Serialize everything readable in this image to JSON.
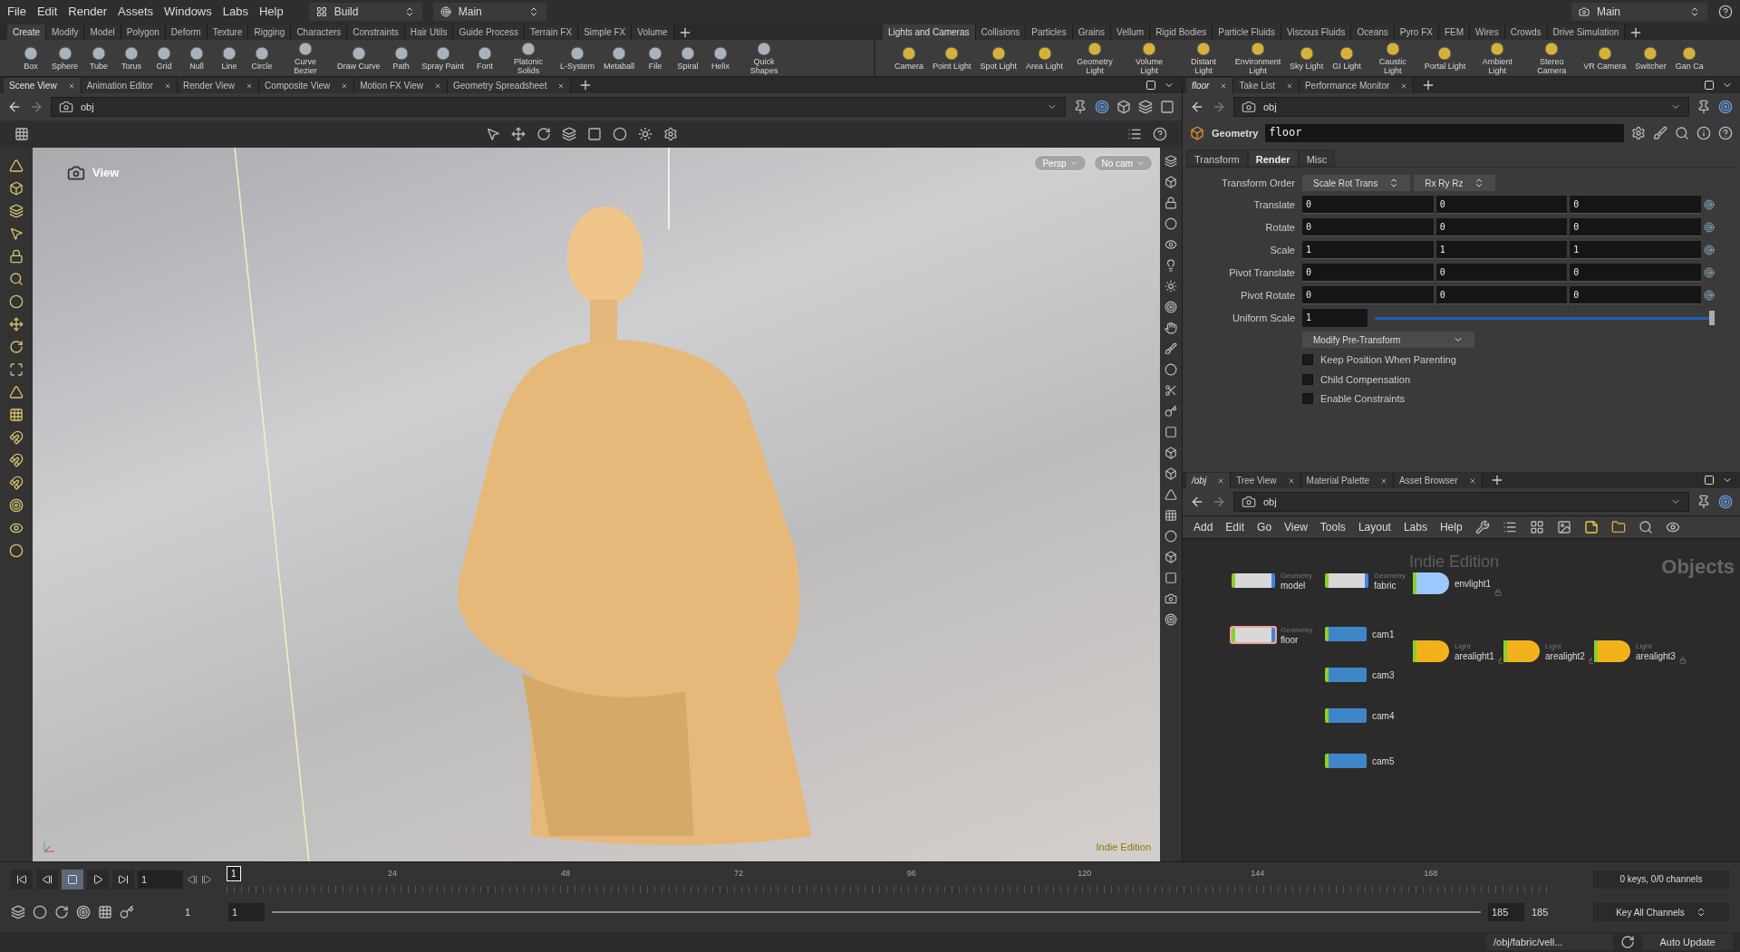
{
  "menu": [
    "File",
    "Edit",
    "Render",
    "Assets",
    "Windows",
    "Labs",
    "Help"
  ],
  "desktop_menu": {
    "label": "Build"
  },
  "context_menu": {
    "label": "Main"
  },
  "top_right_menu": {
    "label": "Main"
  },
  "shelf_left": {
    "tabs": [
      {
        "label": "Create",
        "selected": true
      },
      {
        "label": "Modify",
        "selected": false
      },
      {
        "label": "Model",
        "selected": false
      },
      {
        "label": "Polygon",
        "selected": false
      },
      {
        "label": "Deform",
        "selected": false
      },
      {
        "label": "Texture",
        "selected": false
      },
      {
        "label": "Rigging",
        "selected": false
      },
      {
        "label": "Characters",
        "selected": false
      },
      {
        "label": "Constraints",
        "selected": false
      },
      {
        "label": "Hair Utils",
        "selected": false
      },
      {
        "label": "Guide Process",
        "selected": false
      },
      {
        "label": "Terrain FX",
        "selected": false
      },
      {
        "label": "Simple FX",
        "selected": false
      },
      {
        "label": "Volume",
        "selected": false
      }
    ],
    "tools": [
      "Box",
      "Sphere",
      "Tube",
      "Torus",
      "Grid",
      "Null",
      "Line",
      "Circle",
      "Curve Bezier",
      "Draw Curve",
      "Path",
      "Spray Paint",
      "Font",
      "Platonic Solids",
      "L-System",
      "Metaball",
      "File",
      "Spiral",
      "Helix",
      "Quick Shapes"
    ]
  },
  "shelf_right": {
    "tabs": [
      {
        "label": "Lights and Cameras",
        "selected": true
      },
      {
        "label": "Collisions",
        "selected": false
      },
      {
        "label": "Particles",
        "selected": false
      },
      {
        "label": "Grains",
        "selected": false
      },
      {
        "label": "Vellum",
        "selected": false
      },
      {
        "label": "Rigid Bodies",
        "selected": false
      },
      {
        "label": "Particle Fluids",
        "selected": false
      },
      {
        "label": "Viscous Fluids",
        "selected": false
      },
      {
        "label": "Oceans",
        "selected": false
      },
      {
        "label": "Pyro FX",
        "selected": false
      },
      {
        "label": "FEM",
        "selected": false
      },
      {
        "label": "Wires",
        "selected": false
      },
      {
        "label": "Crowds",
        "selected": false
      },
      {
        "label": "Drive Simulation",
        "selected": false
      }
    ],
    "tools": [
      "Camera",
      "Point Light",
      "Spot Light",
      "Area Light",
      "Geometry Light",
      "Volume Light",
      "Distant Light",
      "Environment Light",
      "Sky Light",
      "GI Light",
      "Caustic Light",
      "Portal Light",
      "Ambient Light",
      "Stereo Camera",
      "VR Camera",
      "Switcher",
      "Gan Ca"
    ]
  },
  "left_pane": {
    "tabs": [
      {
        "label": "Scene View",
        "selected": true
      },
      {
        "label": "Animation Editor",
        "selected": false
      },
      {
        "label": "Render View",
        "selected": false
      },
      {
        "label": "Composite View",
        "selected": false
      },
      {
        "label": "Motion FX View",
        "selected": false
      },
      {
        "label": "Geometry Spreadsheet",
        "selected": false
      }
    ],
    "path": "obj"
  },
  "viewport": {
    "title": "View",
    "projection": "Persp",
    "camera": "No cam",
    "edition": "Indie Edition"
  },
  "right_pane": {
    "tabs": [
      {
        "label": "floor",
        "selected": true
      },
      {
        "label": "Take List",
        "selected": false
      },
      {
        "label": "Performance Monitor",
        "selected": false
      }
    ],
    "path": "obj"
  },
  "parameters": {
    "node_type": "Geometry",
    "node_name": "floor",
    "tabs": [
      {
        "label": "Transform",
        "selected": false
      },
      {
        "label": "Render",
        "selected": true
      },
      {
        "label": "Misc",
        "selected": false
      }
    ],
    "transform_order": {
      "label": "Transform Order",
      "values": [
        "Scale Rot Trans",
        "Rx Ry Rz"
      ]
    },
    "vectors": [
      {
        "label": "Translate",
        "values": [
          "0",
          "0",
          "0"
        ]
      },
      {
        "label": "Rotate",
        "values": [
          "0",
          "0",
          "0"
        ]
      },
      {
        "label": "Scale",
        "values": [
          "1",
          "1",
          "1"
        ]
      },
      {
        "label": "Pivot Translate",
        "values": [
          "0",
          "0",
          "0"
        ]
      },
      {
        "label": "Pivot Rotate",
        "values": [
          "0",
          "0",
          "0"
        ]
      }
    ],
    "uniform_scale": {
      "label": "Uniform Scale",
      "value": "1",
      "level": 1
    },
    "pre_transform": "Modify Pre-Transform",
    "checkboxes": [
      {
        "label": "Keep Position When Parenting",
        "checked": false
      },
      {
        "label": "Child Compensation",
        "checked": false
      },
      {
        "label": "Enable Constraints",
        "checked": false
      }
    ]
  },
  "network": {
    "tabs": [
      {
        "label": "/obj",
        "selected": true
      },
      {
        "label": "Tree View",
        "selected": false
      },
      {
        "label": "Material Palette",
        "selected": false
      },
      {
        "label": "Asset Browser",
        "selected": false
      }
    ],
    "path": "obj",
    "menu": [
      "Add",
      "Edit",
      "Go",
      "View",
      "Tools",
      "Layout",
      "Labs",
      "Help"
    ],
    "edition": "Indie Edition",
    "context": "Objects",
    "nodes": [
      {
        "kind": "geometry",
        "type_label": "Geometry",
        "name": "model",
        "selected": false
      },
      {
        "kind": "geometry",
        "type_label": "Geometry",
        "name": "fabric",
        "selected": false
      },
      {
        "kind": "envlight",
        "name": "envlight1",
        "selected": false
      },
      {
        "kind": "geometry",
        "type_label": "Geometry",
        "name": "floor",
        "selected": true
      },
      {
        "kind": "camera",
        "name": "cam1",
        "selected": false
      },
      {
        "kind": "light",
        "type_label": "Light",
        "name": "arealight1",
        "selected": false
      },
      {
        "kind": "light",
        "type_label": "Light",
        "name": "arealight2",
        "selected": false
      },
      {
        "kind": "light",
        "type_label": "Light",
        "name": "arealight3",
        "selected": false
      },
      {
        "kind": "camera",
        "name": "cam3",
        "selected": false
      },
      {
        "kind": "camera",
        "name": "cam4",
        "selected": false
      },
      {
        "kind": "camera",
        "name": "cam5",
        "selected": false
      }
    ]
  },
  "timeline": {
    "frame": "1",
    "marker": "1",
    "ticks": [
      "24",
      "48",
      "72",
      "96",
      "120",
      "144",
      "168"
    ],
    "range_start": "1",
    "playback_start": "1",
    "playback_end": "185",
    "range_end": "185",
    "keys": "0 keys, 0/0 channels",
    "key_mode": "Key All Channels"
  },
  "status": {
    "path": "/obj/fabric/vell...",
    "update_mode": "Auto Update"
  }
}
